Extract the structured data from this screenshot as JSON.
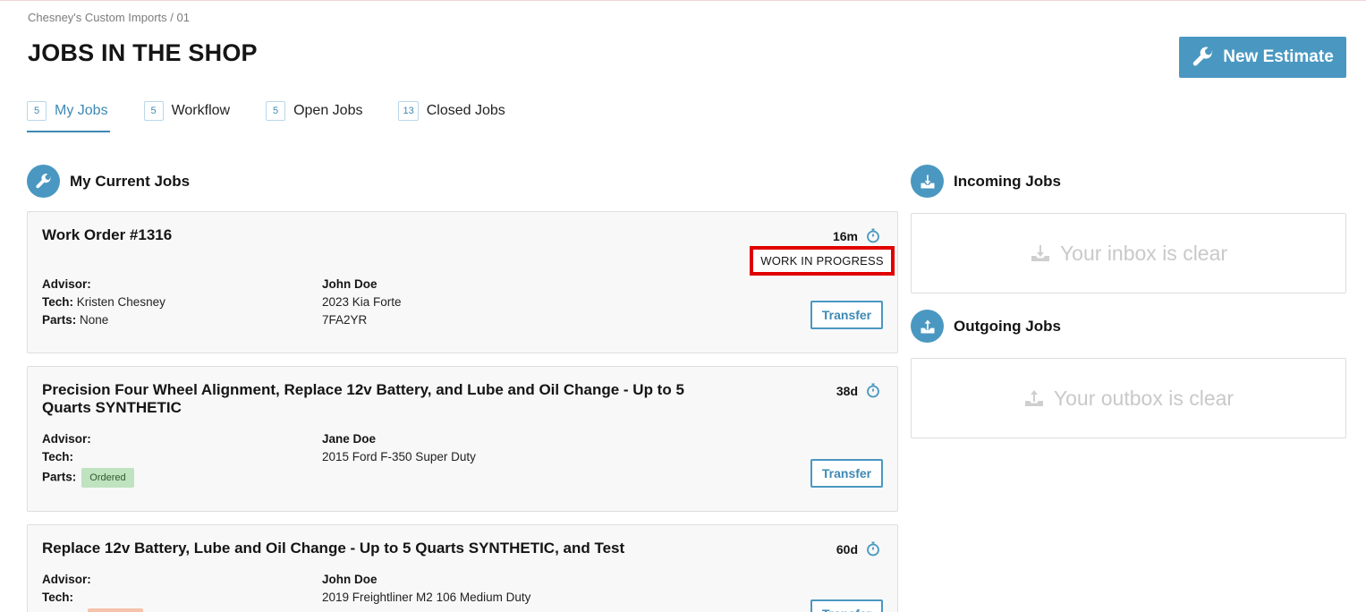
{
  "breadcrumb": "Chesney's Custom Imports / 01",
  "page_title": "JOBS IN THE SHOP",
  "new_estimate_label": "New Estimate",
  "tabs": [
    {
      "count": "5",
      "label": "My Jobs",
      "active": true
    },
    {
      "count": "5",
      "label": "Workflow",
      "active": false
    },
    {
      "count": "5",
      "label": "Open Jobs",
      "active": false
    },
    {
      "count": "13",
      "label": "Closed Jobs",
      "active": false
    }
  ],
  "current_jobs": {
    "title": "My Current Jobs",
    "jobs": [
      {
        "title": "Work Order #1316",
        "elapsed": "16m",
        "status": "WORK IN PROGRESS",
        "advisor_label": "Advisor:",
        "tech_label": "Tech:",
        "tech": "Kristen Chesney",
        "parts_label": "Parts:",
        "parts": "None",
        "customer": "John Doe",
        "vehicle": "2023 Kia Forte",
        "plate": "7FA2YR",
        "transfer_label": "Transfer"
      },
      {
        "title": "Precision Four Wheel Alignment, Replace 12v Battery, and Lube and Oil Change - Up to 5 Quarts SYNTHETIC",
        "elapsed": "38d",
        "advisor_label": "Advisor:",
        "tech_label": "Tech:",
        "parts_label": "Parts:",
        "parts_badge": "Ordered",
        "customer": "Jane Doe",
        "vehicle": "2015 Ford F-350 Super Duty",
        "transfer_label": "Transfer"
      },
      {
        "title": "Replace 12v Battery, Lube and Oil Change - Up to 5 Quarts SYNTHETIC, and Test",
        "elapsed": "60d",
        "advisor_label": "Advisor:",
        "tech_label": "Tech:",
        "customer": "John Doe",
        "vehicle": "2019 Freightliner M2 106 Medium Duty",
        "transfer_label": "Transfer"
      }
    ]
  },
  "incoming": {
    "title": "Incoming Jobs",
    "empty_text": "Your inbox is clear"
  },
  "outgoing": {
    "title": "Outgoing Jobs",
    "empty_text": "Your outbox is clear"
  },
  "icons": {
    "new_estimate": "wrench-icon",
    "current_jobs": "wrench-icon",
    "timer": "stopwatch-icon",
    "incoming": "download-icon",
    "outgoing": "upload-icon"
  },
  "colors": {
    "accent": "#4a98c1",
    "status_highlight": "#e00000",
    "ordered_badge": "#bfe2bf",
    "pending_badge": "#f5c2ac"
  }
}
